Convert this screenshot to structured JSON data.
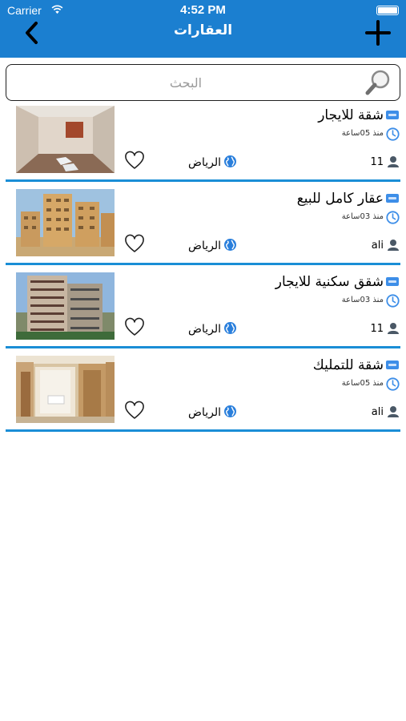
{
  "status_bar": {
    "carrier": "Carrier",
    "time": "4:52 PM"
  },
  "nav": {
    "title": "العقارات",
    "back_icon": "chevron-left-icon",
    "add_icon": "plus-icon"
  },
  "search": {
    "placeholder": "البحث",
    "value": "",
    "icon": "magnifier-icon"
  },
  "colors": {
    "header": "#1b7fd0",
    "separator": "#1a8ed6",
    "accent_icon": "#3d8ee8"
  },
  "listings": [
    {
      "title": "شقة للايجار",
      "time": "منذ 05ساعة",
      "user": "11",
      "city": "الرياض",
      "image": "empty-room-photo"
    },
    {
      "title": "عقار كامل للبيع",
      "time": "منذ 03ساعة",
      "user": "ali",
      "city": "الرياض",
      "image": "apartment-blocks-photo"
    },
    {
      "title": "شقق سكنية للايجار",
      "time": "منذ 03ساعة",
      "user": "11",
      "city": "الرياض",
      "image": "tower-building-photo"
    },
    {
      "title": "شقة للتمليك",
      "time": "منذ 05ساعة",
      "user": "ali",
      "city": "الرياض",
      "image": "interior-rooms-photo"
    }
  ]
}
